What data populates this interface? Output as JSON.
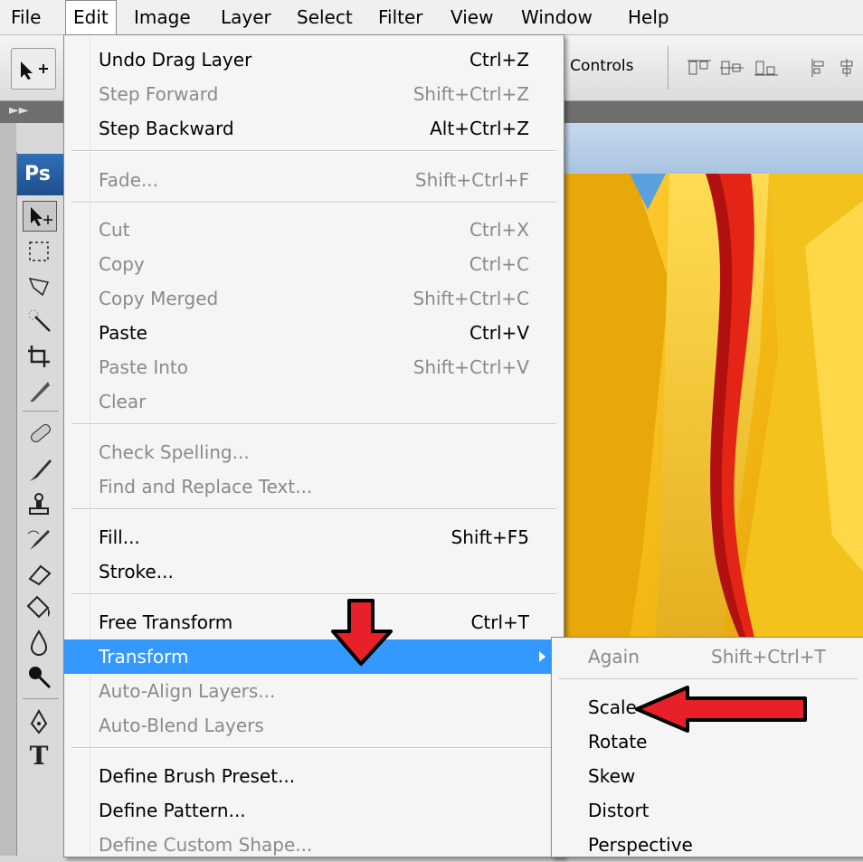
{
  "menubar": {
    "items": [
      "File",
      "Edit",
      "Image",
      "Layer",
      "Select",
      "Filter",
      "View",
      "Window",
      "Help"
    ],
    "active": "Edit"
  },
  "options_bar": {
    "controls_label": "n Controls"
  },
  "toolbox": {
    "logo": "Ps"
  },
  "edit_menu": {
    "undo": {
      "label": "Undo Drag Layer",
      "shortcut": "Ctrl+Z"
    },
    "step_forward": {
      "label": "Step Forward",
      "shortcut": "Shift+Ctrl+Z"
    },
    "step_backward": {
      "label": "Step Backward",
      "shortcut": "Alt+Ctrl+Z"
    },
    "fade": {
      "label": "Fade...",
      "shortcut": "Shift+Ctrl+F"
    },
    "cut": {
      "label": "Cut",
      "shortcut": "Ctrl+X"
    },
    "copy": {
      "label": "Copy",
      "shortcut": "Ctrl+C"
    },
    "copy_merged": {
      "label": "Copy Merged",
      "shortcut": "Shift+Ctrl+C"
    },
    "paste": {
      "label": "Paste",
      "shortcut": "Ctrl+V"
    },
    "paste_into": {
      "label": "Paste Into",
      "shortcut": "Shift+Ctrl+V"
    },
    "clear": {
      "label": "Clear"
    },
    "check_spelling": {
      "label": "Check Spelling..."
    },
    "find_replace": {
      "label": "Find and Replace Text..."
    },
    "fill": {
      "label": "Fill...",
      "shortcut": "Shift+F5"
    },
    "stroke": {
      "label": "Stroke..."
    },
    "free_transform": {
      "label": "Free Transform",
      "shortcut": "Ctrl+T"
    },
    "transform": {
      "label": "Transform"
    },
    "auto_align": {
      "label": "Auto-Align Layers..."
    },
    "auto_blend": {
      "label": "Auto-Blend Layers"
    },
    "define_brush": {
      "label": "Define Brush Preset..."
    },
    "define_pattern": {
      "label": "Define Pattern..."
    },
    "define_shape": {
      "label": "Define Custom Shape..."
    }
  },
  "transform_submenu": {
    "again": {
      "label": "Again",
      "shortcut": "Shift+Ctrl+T"
    },
    "scale": {
      "label": "Scale"
    },
    "rotate": {
      "label": "Rotate"
    },
    "skew": {
      "label": "Skew"
    },
    "distort": {
      "label": "Distort"
    },
    "perspective": {
      "label": "Perspective"
    }
  },
  "colors": {
    "highlight": "#3399ff",
    "annotation_arrow": "#e8202a"
  }
}
